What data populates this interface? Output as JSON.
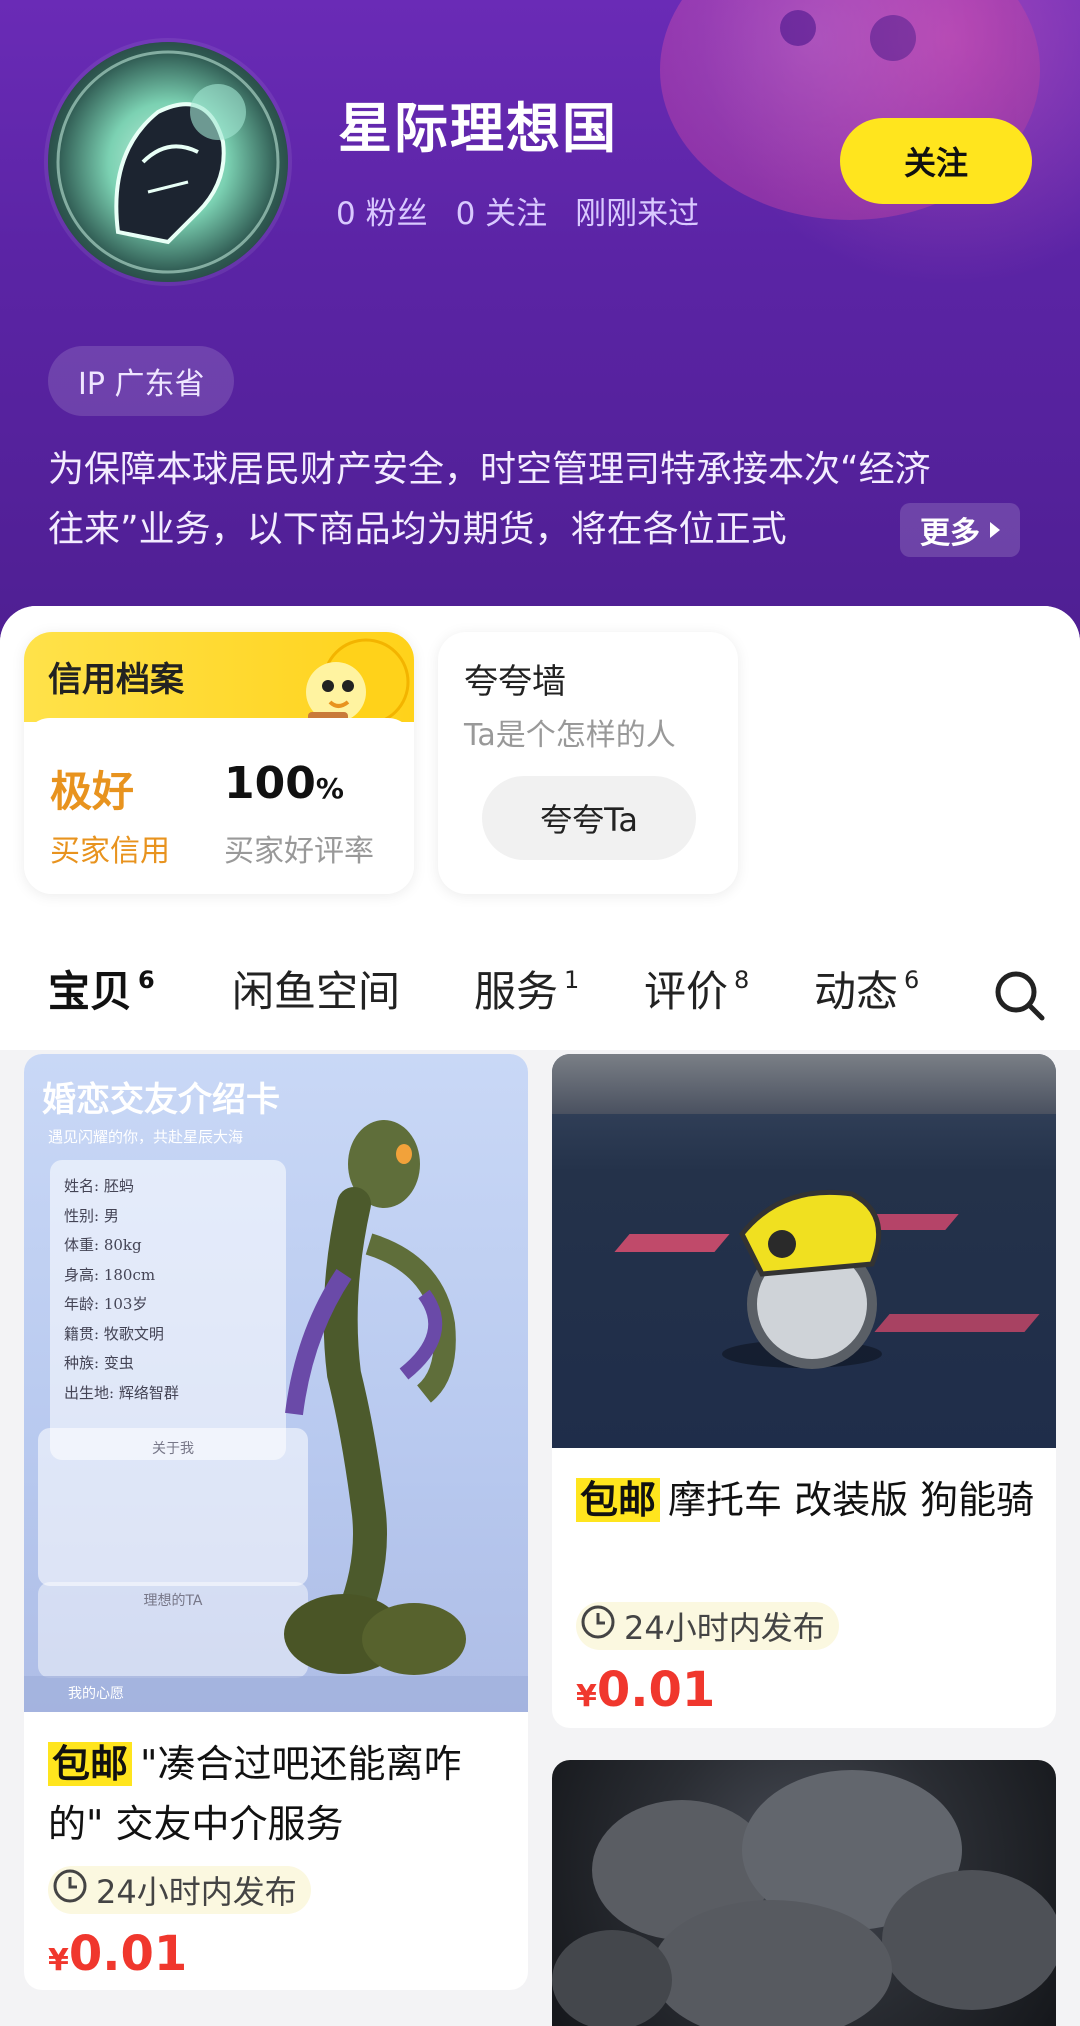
{
  "profile": {
    "name": "星际理想国",
    "fans": "0 粉丝",
    "following": "0 关注",
    "last_seen": "刚刚来过",
    "follow_label": "关注",
    "ip": "IP 广东省",
    "bio_line1": "为保障本球居民财产安全，时空管理司特承接本次“经济",
    "bio_line2": "往来”业务，以下商品均为期货，将在各位正式",
    "more_label": "更多"
  },
  "credit": {
    "title": "信用档案",
    "level": "极好",
    "level_label": "买家信用",
    "rate": "100",
    "rate_unit": "%",
    "rate_label": "买家好评率"
  },
  "praise": {
    "title": "夸夸墙",
    "subtitle": "Ta是个怎样的人",
    "button": "夸夸Ta"
  },
  "tabs": [
    {
      "label": "宝贝",
      "count": "6"
    },
    {
      "label": "闲鱼空间",
      "count": ""
    },
    {
      "label": "服务",
      "count": "1"
    },
    {
      "label": "评价",
      "count": "8"
    },
    {
      "label": "动态",
      "count": "6"
    }
  ],
  "items": [
    {
      "tag": "包邮",
      "title": "\"凑合过吧还能离咋的\" 交友中介服务",
      "time": "24小时内发布",
      "currency": "¥",
      "price": "0.01",
      "card_title": "婚恋交友介绍卡",
      "card_subtitle": "遇见闪耀的你，共赴星辰大海",
      "fields": [
        "姓名:  胚蚂",
        "性别:  男",
        "体重:  80kg",
        "身高:  180cm",
        "年龄:  103岁",
        "籍贯:  牧歌文明",
        "种族:  变虫",
        "出生地:  辉络智群"
      ],
      "about_title": "关于我",
      "ideal_title": "理想的TA",
      "footer": "我的心愿"
    },
    {
      "tag": "包邮",
      "title": "摩托车 改装版 狗能骑",
      "time": "24小时内发布",
      "currency": "¥",
      "price": "0.01"
    }
  ],
  "colors": {
    "accent": "#ffe51e",
    "price": "#f0372d",
    "header": "#5b24a5",
    "credit_orange": "#e8931e"
  }
}
